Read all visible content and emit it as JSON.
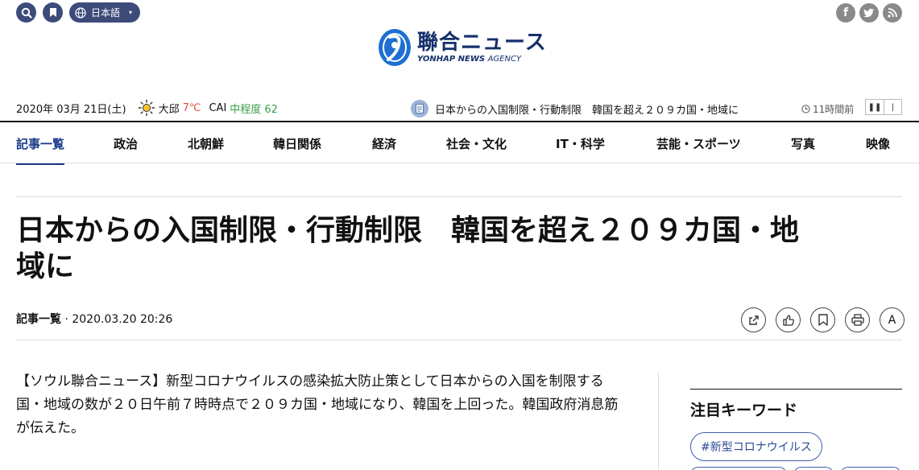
{
  "topbar": {
    "search_icon": "search-icon",
    "bookmark_icon": "bookmark-icon",
    "globe_icon": "globe-icon",
    "language": "日本語",
    "social": [
      "facebook-icon",
      "twitter-icon",
      "rss-icon"
    ]
  },
  "logo": {
    "name_ja": "聯合ニュース",
    "name_en_bold": "YONHAP NEWS",
    "name_en_light": "AGENCY"
  },
  "infobar": {
    "date": "2020年 03月 21日(土)",
    "weather_icon": "sun-icon",
    "city": "大邱",
    "temperature": "7℃",
    "cai_label": "CAI",
    "cai_value": "中程度 62",
    "ticker_headline": "日本からの入国制限・行動制限　韓国を超え２０９カ国・地域に",
    "ticker_time": "11時間前"
  },
  "nav": {
    "items": [
      "記事一覧",
      "政治",
      "北朝鮮",
      "韓日関係",
      "経済",
      "社会・文化",
      "IT・科学",
      "芸能・スポーツ",
      "写真",
      "映像"
    ]
  },
  "article": {
    "headline_line1": "日本からの入国制限・行動制限　韓国を超え２０９カ国・地",
    "headline_line2": "域に",
    "category": "記事一覧",
    "datetime": "2020.03.20 20:26",
    "body": "【ソウル聯合ニュース】新型コロナウイルスの感染拡大防止策として日本からの入国を制限する国・地域の数が２０日午前７時時点で２０９カ国・地域になり、韓国を上回った。韓国政府消息筋が伝えた。"
  },
  "tools": {
    "share_icon": "share-icon",
    "like_icon": "thumbs-up-icon",
    "save_icon": "bookmark-icon",
    "print_icon": "print-icon",
    "font_label": "A"
  },
  "sidebar": {
    "keywords_title": "注目キーワード",
    "keywords": [
      "#新型コロナウイルス"
    ]
  },
  "colors": {
    "brand_navy": "#3d4b7a",
    "logo_blue": "#15306b",
    "nav_active": "#1a3a8a",
    "temp_red": "#e2523d",
    "cai_green": "#3aa04a"
  }
}
